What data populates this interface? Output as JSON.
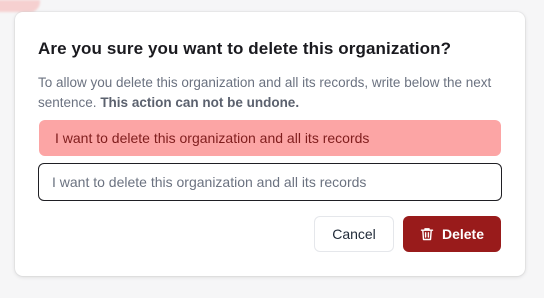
{
  "dialog": {
    "title": "Are you sure you want to delete this organization?",
    "description": "To allow you delete this organization and all its records, write below the next sentence.",
    "description_emphasis": "This action can not be undone.",
    "confirmation_phrase": "I want to delete this organization and all its records",
    "input_value": "I want to delete this organization and all its records",
    "cancel_label": "Cancel",
    "delete_label": "Delete",
    "delete_icon": "trash-icon"
  },
  "colors": {
    "danger": "#991b1b",
    "phrase_background": "#fca5a5",
    "phrase_text": "#7f1d1d"
  }
}
